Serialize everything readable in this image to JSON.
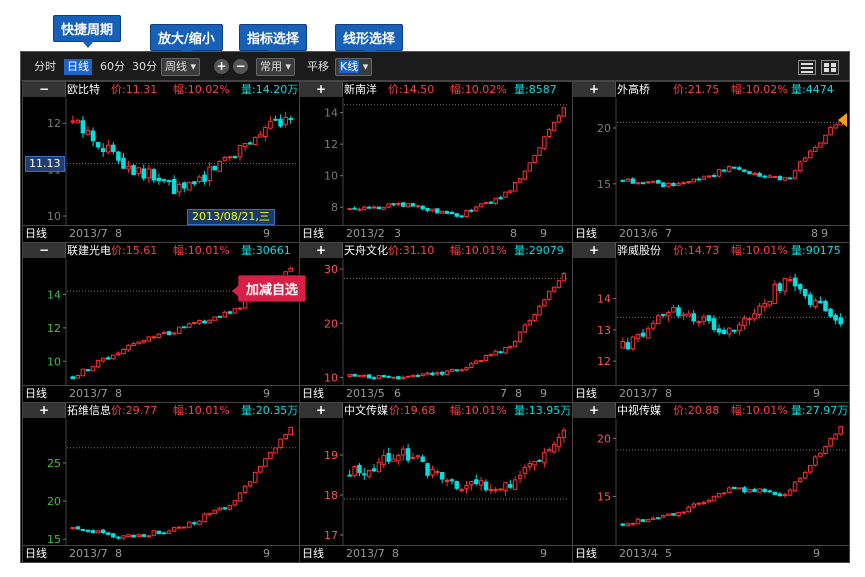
{
  "callouts": {
    "period": "快捷周期",
    "zoom": "放大/缩小",
    "indicator": "指标选择",
    "linetype": "线形选择",
    "addremove": "加减自选"
  },
  "toolbar": {
    "items": [
      "分时",
      "日线",
      "60分",
      "30分",
      "周线"
    ],
    "active": "日线",
    "plus": "+",
    "minus": "−",
    "indicator_select": "常用",
    "pan": "平移",
    "linetype_select": "K线"
  },
  "colors": {
    "up": "#ff3030",
    "down": "#00e0e0",
    "background": "#000000"
  },
  "panels": [
    {
      "btn": "−",
      "name": "欧比特",
      "price": "价:11.31",
      "chg": "幅:10.02%",
      "vol": "量:14.20万",
      "ylabels": [
        "12",
        "11",
        "10"
      ],
      "yvals": [
        12,
        11,
        10
      ],
      "yrange": [
        9.85,
        12.5
      ],
      "ycolor": "gray",
      "ref": 11.13,
      "footer": "日线",
      "xticks": [
        "2013/7",
        "8",
        "9"
      ],
      "tip": "2013/08/21,三",
      "ptip": "11.13"
    },
    {
      "btn": "+",
      "name": "新南洋",
      "price": "价:14.50",
      "chg": "幅:10.02%",
      "vol": "量:8587",
      "ylabels": [
        "14",
        "12",
        "10",
        "8"
      ],
      "yvals": [
        14,
        12,
        10,
        8
      ],
      "yrange": [
        7.0,
        14.8
      ],
      "ycolor": "gray",
      "ref": 14.5,
      "footer": "日线",
      "xticks": [
        "2013/2",
        "3",
        "8",
        "9"
      ]
    },
    {
      "btn": "+",
      "name": "外高桥",
      "price": "价:21.75",
      "chg": "幅:10.02%",
      "vol": "量:4474",
      "ylabels": [
        "20",
        "15"
      ],
      "yvals": [
        20,
        15
      ],
      "yrange": [
        11.5,
        22.5
      ],
      "ycolor": "gray",
      "ref": 20.5,
      "footer": "日线",
      "xticks": [
        "2013/6",
        "7",
        "8",
        "9"
      ]
    },
    {
      "btn": "−",
      "name": "联建光电",
      "price": "价:15.61",
      "chg": "幅:10.01%",
      "vol": "量:30661",
      "ylabels": [
        "14",
        "12",
        "10"
      ],
      "yvals": [
        14,
        12,
        10
      ],
      "yrange": [
        8.7,
        16.0
      ],
      "ycolor": "green",
      "ref": 14.2,
      "footer": "日线",
      "xticks": [
        "2013/7",
        "8",
        "9"
      ]
    },
    {
      "btn": "+",
      "name": "天舟文化",
      "price": "价:31.10",
      "chg": "幅:10.01%",
      "vol": "量:29079",
      "ylabels": [
        "30",
        "20",
        "10"
      ],
      "yvals": [
        30,
        20,
        10
      ],
      "yrange": [
        9.0,
        31.5
      ],
      "ycolor": "red",
      "ref": 28.3,
      "footer": "日线",
      "xticks": [
        "2013/5",
        "6",
        "7",
        "8",
        "9"
      ]
    },
    {
      "btn": "+",
      "name": "骅威股份",
      "price": "价:14.73",
      "chg": "幅:10.01%",
      "vol": "量:90175",
      "ylabels": [
        "14",
        "13",
        "12"
      ],
      "yvals": [
        14,
        13,
        12
      ],
      "yrange": [
        11.3,
        15.2
      ],
      "ycolor": "red",
      "ref": 13.4,
      "footer": "日线",
      "xticks": [
        "2013/7",
        "8",
        "9"
      ]
    },
    {
      "btn": "+",
      "name": "拓维信息",
      "price": "价:29.77",
      "chg": "幅:10.01%",
      "vol": "量:20.35万",
      "ylabels": [
        "25",
        "20",
        "15"
      ],
      "yvals": [
        25,
        20,
        15
      ],
      "yrange": [
        14.5,
        30.5
      ],
      "ycolor": "green",
      "ref": 27.0,
      "footer": "日线",
      "xticks": [
        "2013/7",
        "8",
        "9"
      ]
    },
    {
      "btn": "+",
      "name": "中文传媒",
      "price": "价:19.68",
      "chg": "幅:10.01%",
      "vol": "量:13.95万",
      "ylabels": [
        "19",
        "18",
        "17"
      ],
      "yvals": [
        19,
        18,
        17
      ],
      "yrange": [
        16.8,
        19.85
      ],
      "ycolor": "red",
      "ref": 17.9,
      "footer": "日线",
      "xticks": [
        "2013/7",
        "8",
        "9"
      ]
    },
    {
      "btn": "+",
      "name": "中视传媒",
      "price": "价:20.88",
      "chg": "幅:10.01%",
      "vol": "量:27.97万",
      "ylabels": [
        "20",
        "15"
      ],
      "yvals": [
        20,
        15
      ],
      "yrange": [
        11.0,
        21.5
      ],
      "ycolor": "red",
      "ref": 19.0,
      "footer": "日线",
      "xticks": [
        "2013/4",
        "5",
        "9"
      ]
    }
  ]
}
